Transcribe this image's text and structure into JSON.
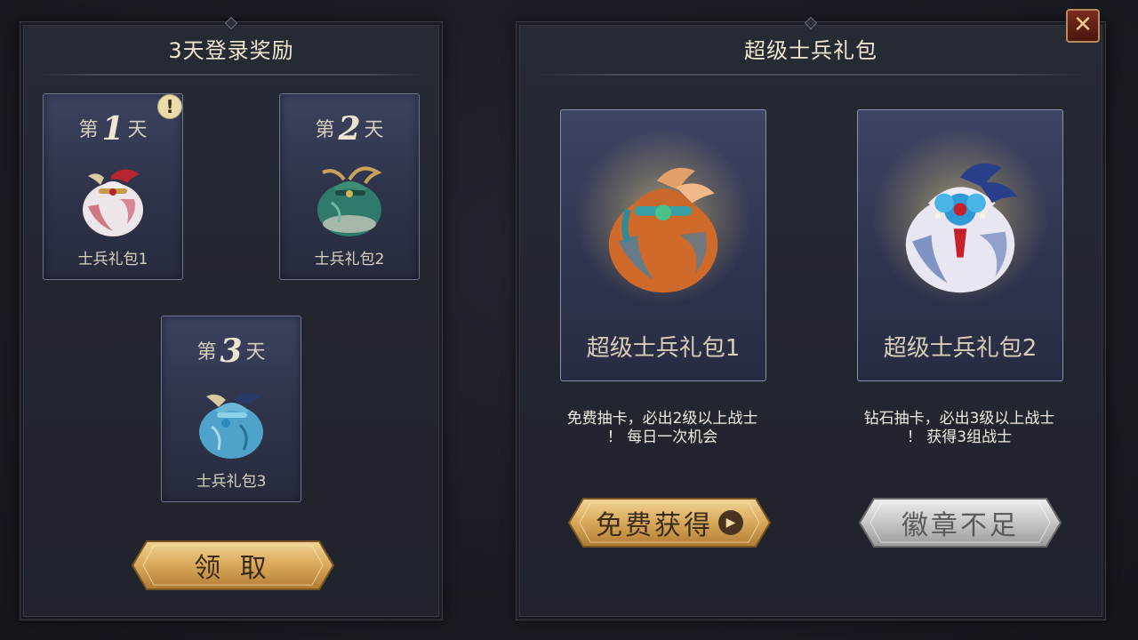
{
  "login_panel": {
    "title": "3天登录奖励",
    "days": [
      {
        "prefix": "第",
        "num": "1",
        "suffix": "天",
        "name": "士兵礼包1",
        "alert": "!"
      },
      {
        "prefix": "第",
        "num": "2",
        "suffix": "天",
        "name": "士兵礼包2"
      },
      {
        "prefix": "第",
        "num": "3",
        "suffix": "天",
        "name": "士兵礼包3"
      }
    ],
    "claim_label": "领 取"
  },
  "pack_panel": {
    "title": "超级士兵礼包",
    "packs": [
      {
        "name": "超级士兵礼包1",
        "desc_line1": "免费抽卡，必出2级以上战士",
        "desc_line2": "！ 每日一次机会",
        "button_label": "免费获得",
        "button_state": "active"
      },
      {
        "name": "超级士兵礼包2",
        "desc_line1": "钻石抽卡，必出3级以上战士",
        "desc_line2": "！ 获得3组战士",
        "button_label": "徽章不足",
        "button_state": "disabled"
      }
    ]
  },
  "icons": {
    "close": "close-icon",
    "play": "play-icon",
    "alert": "exclamation-icon"
  },
  "colors": {
    "gold_button": "#d9a85a",
    "gray_button": "#c9c9c9",
    "card_bg": "#2f3450",
    "title_text": "#f1e6cf"
  }
}
